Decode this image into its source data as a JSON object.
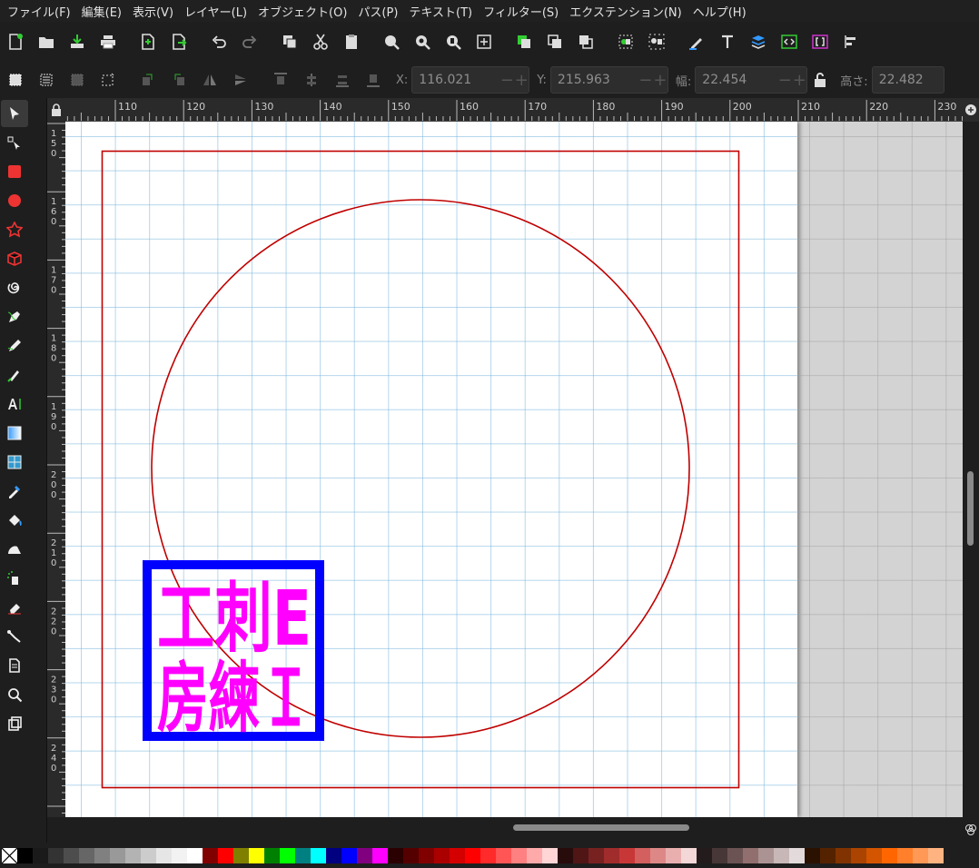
{
  "menu": [
    "ファイル(F)",
    "編集(E)",
    "表示(V)",
    "レイヤー(L)",
    "オブジェクト(O)",
    "パス(P)",
    "テキスト(T)",
    "フィルター(S)",
    "エクステンション(N)",
    "ヘルプ(H)"
  ],
  "controls": {
    "x_label": "X:",
    "x_value": "116.021",
    "y_label": "Y:",
    "y_value": "215.963",
    "w_label": "幅:",
    "w_value": "22.454",
    "h_label": "高さ:",
    "h_value": "22.482"
  },
  "hruler_labels": [
    "110",
    "120",
    "130",
    "140",
    "150",
    "160",
    "170",
    "180",
    "190",
    "200",
    "210",
    "220",
    "230"
  ],
  "vruler_labels": [
    "1\n5\n0",
    "1\n6\n0",
    "1\n7\n0",
    "1\n8\n0",
    "1\n9\n0",
    "2\n0\n0",
    "2\n1\n0",
    "2\n2\n0",
    "2\n3\n0",
    "2\n4\n0"
  ],
  "drawing": {
    "stamp_text": [
      "工刺E",
      "房練Ｉ"
    ],
    "stamp_colors": {
      "border": "#0000ff",
      "text": "#ff00ff"
    },
    "frame_color": "#c00000"
  },
  "palette": [
    "#000000",
    "#1a1a1a",
    "#333333",
    "#4d4d4d",
    "#666666",
    "#808080",
    "#999999",
    "#b3b3b3",
    "#cccccc",
    "#e6e6e6",
    "#f2f2f2",
    "#ffffff",
    "#800000",
    "#ff0000",
    "#808000",
    "#ffff00",
    "#008000",
    "#00ff00",
    "#008080",
    "#00ffff",
    "#000080",
    "#0000ff",
    "#800080",
    "#ff00ff",
    "#2b0000",
    "#550000",
    "#800000",
    "#aa0000",
    "#d40000",
    "#ff0000",
    "#ff2a2a",
    "#ff5555",
    "#ff8080",
    "#ffaaaa",
    "#ffd5d5",
    "#280b0b",
    "#501616",
    "#782121",
    "#a02c2c",
    "#c83737",
    "#d35f5f",
    "#de8787",
    "#e9afaf",
    "#f4d7d7",
    "#241c1c",
    "#483737",
    "#6c5353",
    "#916f6f",
    "#ac9393",
    "#c8b7b7",
    "#e3dbdb",
    "#2b1100",
    "#552200",
    "#803300",
    "#aa4400",
    "#d45500",
    "#ff6600",
    "#ff7f2a",
    "#ff9955",
    "#ffb380"
  ]
}
